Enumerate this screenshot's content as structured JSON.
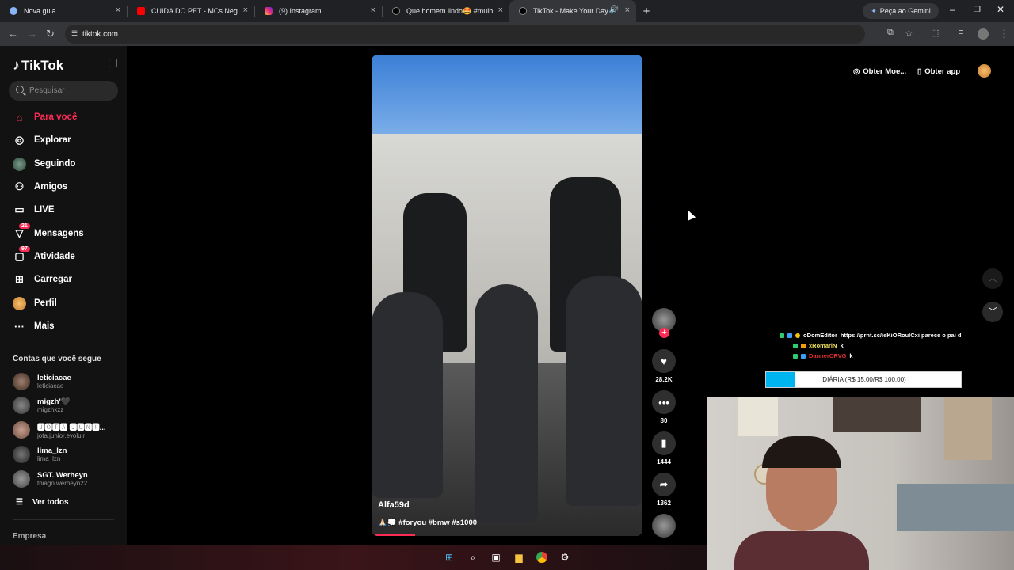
{
  "browser": {
    "tabs": [
      {
        "title": "Nova guia",
        "close": "×"
      },
      {
        "title": "CUIDA DO PET - MCs Negão Original",
        "close": "×"
      },
      {
        "title": "(9) Instagram",
        "close": "×"
      },
      {
        "title": "Que homem lindo🤩 #mulheres",
        "close": "×"
      },
      {
        "title": "TikTok - Make Your Day",
        "close": "×"
      }
    ],
    "new_tab": "+",
    "gemini_label": "Peça ao Gemini",
    "url": "tiktok.com"
  },
  "sidebar": {
    "logo": "TikTok",
    "search_placeholder": "Pesquisar",
    "nav": [
      {
        "label": "Para você",
        "icon": "home-icon"
      },
      {
        "label": "Explorar",
        "icon": "compass-icon"
      },
      {
        "label": "Seguindo",
        "icon": "following-avatar-icon"
      },
      {
        "label": "Amigos",
        "icon": "friends-icon"
      },
      {
        "label": "LIVE",
        "icon": "live-icon"
      },
      {
        "label": "Mensagens",
        "icon": "messages-icon",
        "badge": "21"
      },
      {
        "label": "Atividade",
        "icon": "activity-icon",
        "badge": "97"
      },
      {
        "label": "Carregar",
        "icon": "upload-icon"
      },
      {
        "label": "Perfil",
        "icon": "profile-avatar-icon"
      },
      {
        "label": "Mais",
        "icon": "more-icon"
      }
    ],
    "following_title": "Contas que você segue",
    "accounts": [
      {
        "name": "leticiacae",
        "handle": "leticiacae"
      },
      {
        "name": "migzh'🖤",
        "handle": "migzhxzz"
      },
      {
        "name": "🅹🅾🆃🅰 🅹🆄🅽🅸...",
        "handle": "jota.junior.evoluir"
      },
      {
        "name": "lima_lzn",
        "handle": "lima_lzn"
      },
      {
        "name": "SGT. Werheyn",
        "handle": "thiago.werheyn22"
      }
    ],
    "see_all": "Ver todos",
    "company": "Empresa"
  },
  "topbar": {
    "coins": "Obter Moe...",
    "app": "Obter app"
  },
  "video": {
    "author": "Alfa59d",
    "caption": "🙏🏻💭 #foryou #bmw #s1000",
    "likes": "28.2K",
    "comments": "80",
    "saves": "1444",
    "shares": "1362",
    "progress": 0.15
  },
  "overlay": {
    "chat": [
      {
        "user": "oDomEditor",
        "msg": "https://prnt.sc/ieKiORoulCxi parece o pai d",
        "color": "#ffffff"
      },
      {
        "user": "xRomariN",
        "msg": "k",
        "color": "#f0e060"
      },
      {
        "user": "DannerCRVG",
        "msg": "k",
        "color": "#e03030"
      }
    ],
    "goal_text": "DIÁRIA (R$ 15,00/R$ 100,00)",
    "goal_fraction": 0.15
  }
}
